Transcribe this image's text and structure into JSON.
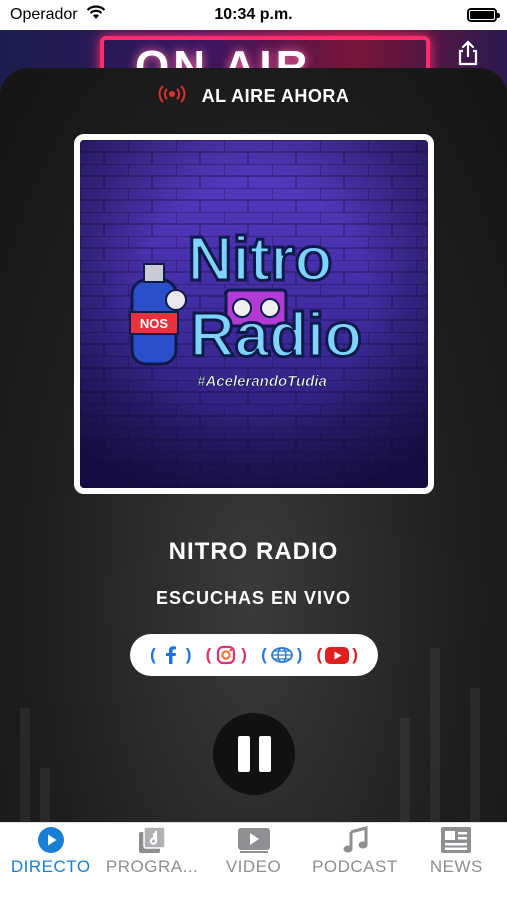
{
  "status_bar": {
    "carrier": "Operador",
    "time": "10:34 p.m."
  },
  "header": {
    "banner_text": "ON AIR"
  },
  "player": {
    "live_label": "AL AIRE AHORA",
    "station_name": "NITRO RADIO",
    "subtitle": "ESCUCHAS EN VIVO",
    "artwork": {
      "logo_line1": "Nitro",
      "logo_line2": "Radio",
      "hashtag": "#AcelerandoTudia",
      "tank_label": "NOS"
    },
    "social": [
      {
        "name": "facebook",
        "icon": "facebook-icon"
      },
      {
        "name": "instagram",
        "icon": "instagram-icon"
      },
      {
        "name": "website",
        "icon": "globe-icon"
      },
      {
        "name": "youtube",
        "icon": "youtube-icon"
      }
    ],
    "state": "playing"
  },
  "tabs": [
    {
      "label": "DIRECTO",
      "icon": "play-circle-icon",
      "active": true
    },
    {
      "label": "PROGRA...",
      "icon": "program-icon",
      "active": false
    },
    {
      "label": "VIDEO",
      "icon": "video-icon",
      "active": false
    },
    {
      "label": "PODCAST",
      "icon": "music-note-icon",
      "active": false
    },
    {
      "label": "NEWS",
      "icon": "news-icon",
      "active": false
    }
  ],
  "colors": {
    "accent": "#1a7fd4",
    "live_red": "#e03030",
    "tab_inactive": "#8e8e93"
  }
}
